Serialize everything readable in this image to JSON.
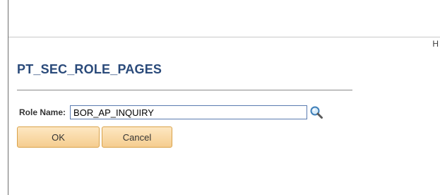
{
  "header": {
    "link_label": "H"
  },
  "page": {
    "title": "PT_SEC_ROLE_PAGES"
  },
  "form": {
    "role_name_label": "Role Name:",
    "role_name_value": "BOR_AP_INQUIRY",
    "lookup_icon": "magnifier-lookup-icon"
  },
  "buttons": {
    "ok_label": "OK",
    "cancel_label": "Cancel"
  },
  "colors": {
    "title": "#2a4a7a",
    "button_fill": "#f5cd8f",
    "button_border": "#d9a24a",
    "input_border": "#5a7bb0"
  }
}
